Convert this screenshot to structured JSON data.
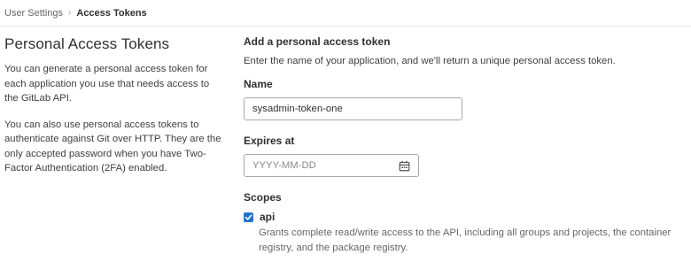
{
  "breadcrumb": {
    "parent": "User Settings",
    "separator": "›",
    "current": "Access Tokens"
  },
  "intro": {
    "title": "Personal Access Tokens",
    "paragraph1": "You can generate a personal access token for each application you use that needs access to the GitLab API.",
    "paragraph2": "You can also use personal access tokens to authenticate against Git over HTTP. They are the only accepted password when you have Two-Factor Authentication (2FA) enabled."
  },
  "form": {
    "heading": "Add a personal access token",
    "description": "Enter the name of your application, and we'll return a unique personal access token.",
    "name_label": "Name",
    "name_value": "sysadmin-token-one",
    "expires_label": "Expires at",
    "expires_placeholder": "YYYY-MM-DD",
    "expires_icon": "calendar-icon",
    "scopes_label": "Scopes",
    "scopes": [
      {
        "name": "api",
        "checked": true,
        "description": "Grants complete read/write access to the API, including all groups and projects, the container registry, and the package registry."
      }
    ]
  },
  "colors": {
    "checkbox": "#1f75cb",
    "text": "#303030",
    "muted": "#666666"
  }
}
